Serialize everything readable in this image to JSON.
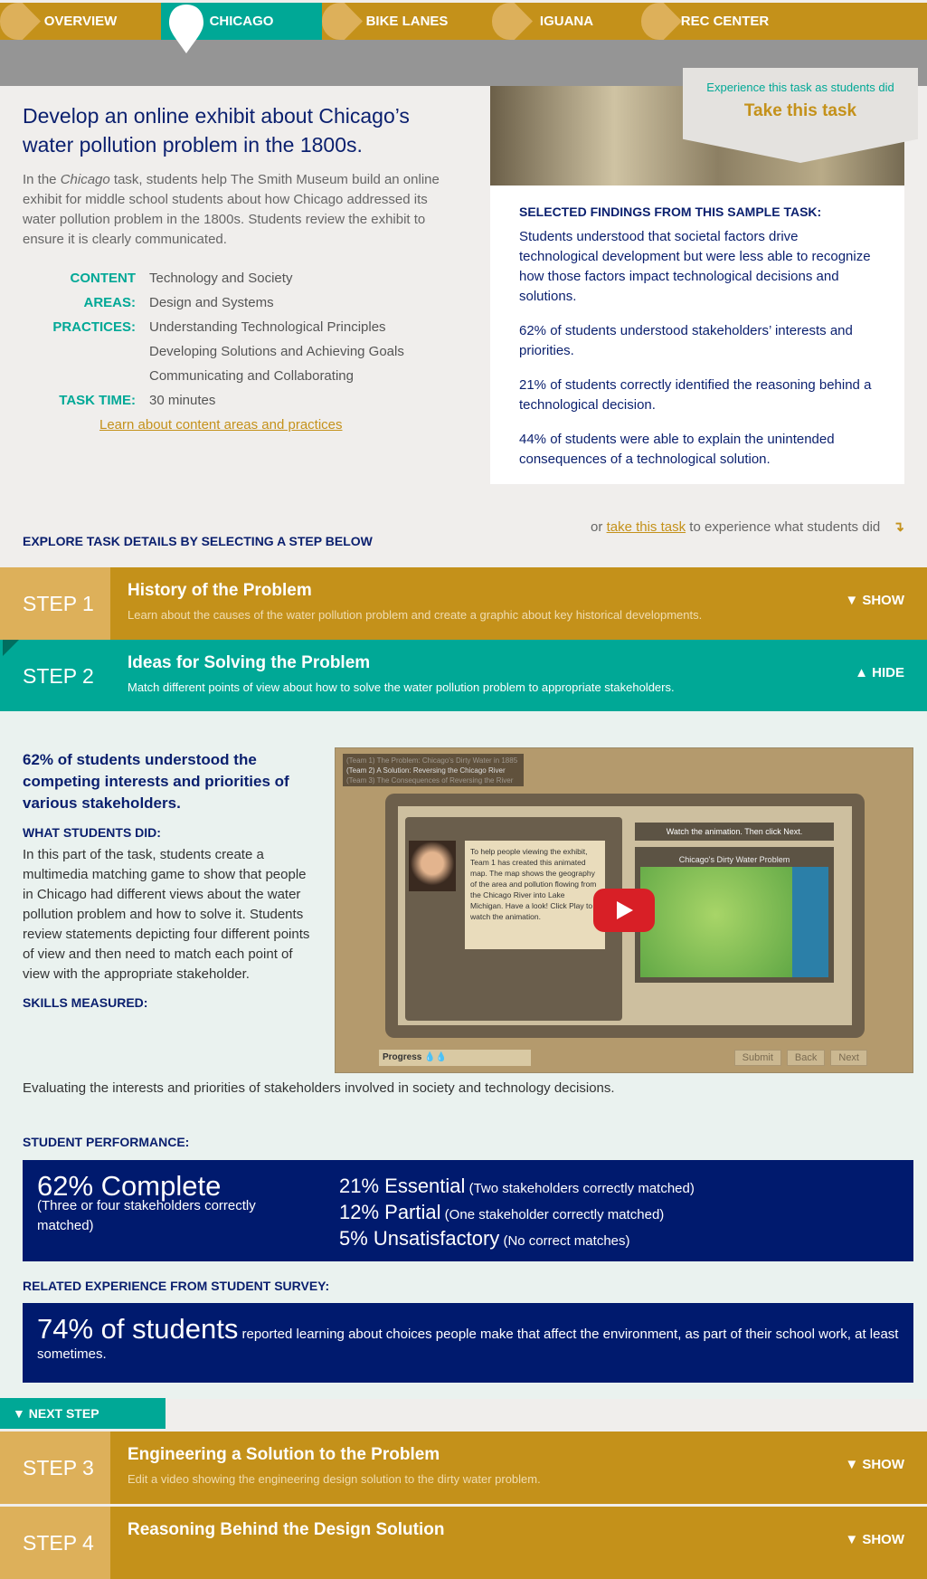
{
  "nav": {
    "items": [
      "OVERVIEW",
      "CHICAGO",
      "BIKE LANES",
      "IGUANA",
      "REC CENTER"
    ],
    "active": "CHICAGO"
  },
  "colors": {
    "gold": "#c4911a",
    "teal": "#00a896",
    "navy": "#001a6e"
  },
  "task": {
    "title": "Develop an online exhibit about Chicago’s water pollution problem in the 1800s.",
    "intro_pre": "In the ",
    "intro_em": "Chicago",
    "intro_post": " task, students help The Smith Museum build an online exhibit for middle school students about how Chicago addressed its water pollution problem in the 1800s. Students review the exhibit to ensure it is clearly communicated.",
    "content_areas_label": "CONTENT AREAS:",
    "content_areas": [
      "Technology and Society",
      "Design and Systems"
    ],
    "practices_label": "PRACTICES:",
    "practices": [
      "Understanding Technological Principles",
      "Developing Solutions and Achieving Goals",
      "Communicating and Collaborating"
    ],
    "time_label": "TASK TIME:",
    "time": "30 minutes",
    "learn_link": "Learn about content areas and practices"
  },
  "callout": {
    "small": "Experience this task as students did",
    "big": "Take this task"
  },
  "findings": {
    "heading": "SELECTED FINDINGS FROM THIS SAMPLE TASK:",
    "items": [
      "Students understood that societal factors drive technological development but were less able to recognize how those factors impact technological decisions and solutions.",
      "62% of students understood stakeholders’ interests and priorities.",
      "21% of students correctly identified the reasoning behind a technological decision.",
      "44% of students were able to explain the unintended consequences of a technological solution."
    ]
  },
  "or_line": {
    "pre": "or ",
    "link": "take this task",
    "post": " to experience what students did",
    "icon": "arrow-down-right-icon"
  },
  "explore": "EXPLORE TASK DETAILS BY SELECTING A STEP BELOW",
  "steps": [
    {
      "num": "STEP 1",
      "title": "History of the Problem",
      "desc": "Learn about the causes of the water pollution problem and create a graphic about key historical developments.",
      "toggle": "▼  SHOW"
    },
    {
      "num": "STEP 2",
      "title": "Ideas for Solving the Problem",
      "desc": "Match different points of view about how to solve the water pollution problem to appropriate stakeholders.",
      "toggle": "▲  HIDE"
    },
    {
      "num": "STEP 3",
      "title": "Engineering a Solution to the Problem",
      "desc": "Edit a video showing the engineering design solution to the dirty water problem.",
      "toggle": "▼  SHOW"
    },
    {
      "num": "STEP 4",
      "title": "Reasoning Behind the Design Solution",
      "desc": "",
      "toggle": "▼  SHOW"
    }
  ],
  "detail": {
    "headline": "62% of students understood the competing interests and priorities of various stakeholders.",
    "did_label": "WHAT STUDENTS DID:",
    "did_text": "In this part of the task, students create a multimedia matching game to show that people in Chicago had different views about the water pollution problem and how to solve it. Students review statements depicting four different points of view and then need to match each point of view with the appropriate stakeholder.",
    "skills_label": "SKILLS MEASURED:",
    "skills_text": "Evaluating the interests and priorities of stakeholders involved in society and technology decisions.",
    "video": {
      "menu": [
        "(Team 1) The Problem: Chicago's Dirty Water in 1885",
        "(Team 2) A Solution: Reversing the Chicago River",
        "(Team 3) The Consequences of Reversing the River"
      ],
      "bubble": "To help people viewing the exhibit, Team 1 has created this animated map. The map shows the geography of the area and pollution flowing from the Chicago River into Lake Michigan. Have a look! Click Play to watch the animation.",
      "watch": "Watch the animation. Then click Next.",
      "map_title": "Chicago's Dirty Water Problem",
      "progress": "Progress",
      "buttons": [
        "Submit",
        "Back",
        "Next"
      ]
    },
    "perf_label": "STUDENT PERFORMANCE:",
    "complete": {
      "big": "62% Complete",
      "sm": "(Three or four stakeholders correctly matched)"
    },
    "levels": [
      {
        "big": "21% Essential",
        "sm": " (Two stakeholders correctly matched)"
      },
      {
        "big": "12% Partial",
        "sm": " (One stakeholder correctly matched)"
      },
      {
        "big": "5% Unsatisfactory",
        "sm": " (No correct matches)"
      }
    ],
    "survey_label": "RELATED EXPERIENCE FROM STUDENT SURVEY:",
    "survey_big": "74% of students",
    "survey_text": " reported learning about choices people make that affect the environment, as part of their school work, at least sometimes."
  },
  "next_step": "▼   NEXT STEP"
}
